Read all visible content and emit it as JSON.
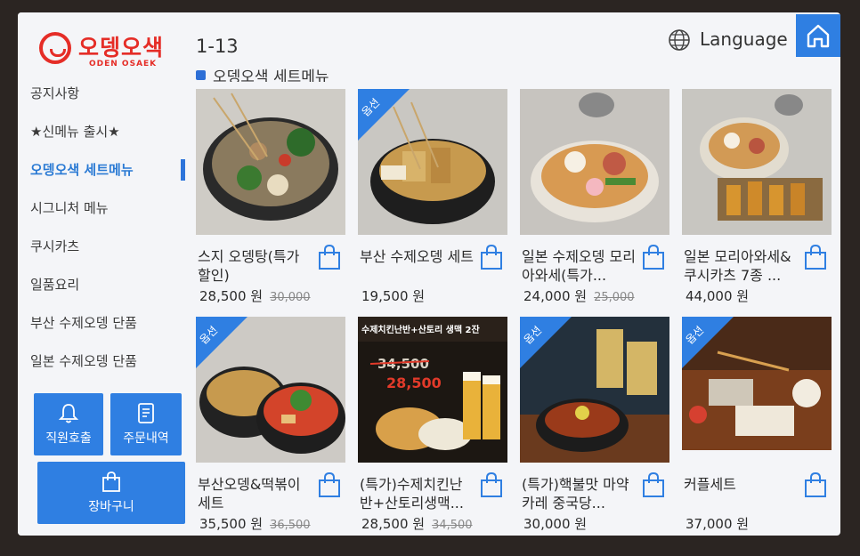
{
  "brand": {
    "name": "오뎅오색",
    "sub": "ODEN OSAEK"
  },
  "header": {
    "pager": "1-13",
    "language": "Language"
  },
  "section": {
    "title": "오뎅오색 세트메뉴"
  },
  "sidebar": {
    "items": [
      {
        "label": "공지사항"
      },
      {
        "label": "★신메뉴 출시★"
      },
      {
        "label": "오뎅오색 세트메뉴"
      },
      {
        "label": "시그니처 메뉴"
      },
      {
        "label": "쿠시카츠"
      },
      {
        "label": "일품요리"
      },
      {
        "label": "부산 수제오뎅 단품"
      },
      {
        "label": "일본 수제오뎅 단품"
      }
    ],
    "staff_call": "직원호출",
    "order_history": "주문내역",
    "cart": "장바구니"
  },
  "products": [
    {
      "name": "스지 오뎅탕(특가할인)",
      "price": "28,500 원",
      "original": "30,000",
      "ribbon": ""
    },
    {
      "name": "부산 수제오뎅 세트",
      "price": "19,500 원",
      "original": "",
      "ribbon": "옵션"
    },
    {
      "name": "일본 수제오뎅 모리아와세(특가...",
      "price": "24,000 원",
      "original": "25,000",
      "ribbon": ""
    },
    {
      "name": "일본 모리아와세&쿠시카츠 7종 ...",
      "price": "44,000 원",
      "original": "",
      "ribbon": ""
    },
    {
      "name": "부산오뎅&떡볶이세트",
      "price": "35,500 원",
      "original": "36,500",
      "ribbon": "옵션"
    },
    {
      "name": "(특가)수제치킨난반+산토리생맥...",
      "price": "28,500 원",
      "original": "34,500",
      "ribbon": "",
      "banner": "수제치킨난반+산토리 생맥 2잔",
      "promo_old": "34,500",
      "promo_new": "28,500"
    },
    {
      "name": "(특가)핵불맛 마약카레 중국당...",
      "price": "30,000 원",
      "original": "",
      "ribbon": "옵션"
    },
    {
      "name": "커플세트",
      "price": "37,000 원",
      "original": "",
      "ribbon": "옵션"
    }
  ],
  "colors": {
    "accent": "#2f7fe2",
    "brand": "#e52d27"
  }
}
